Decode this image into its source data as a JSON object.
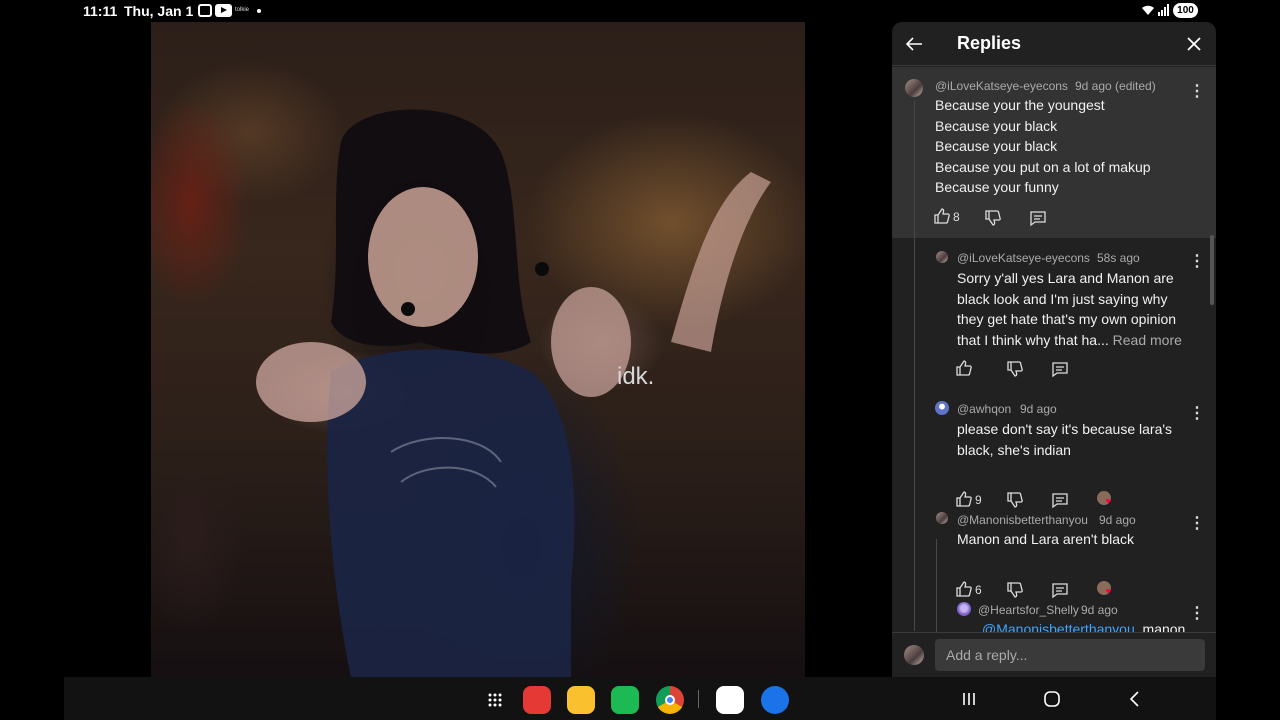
{
  "status_bar": {
    "time": "11:11",
    "date": "Thu, Jan 1",
    "notification_app": "tolkie",
    "battery": "100"
  },
  "video": {
    "caption": "idk."
  },
  "replies_panel": {
    "title": "Replies",
    "comments": [
      {
        "author": "@iLoveKatseye-eyecons",
        "time": "9d ago (edited)",
        "lines": [
          "Because your the youngest",
          "Because your black",
          "Because your black",
          "Because you put on a lot of makup",
          "Because your funny"
        ],
        "likes": "8"
      },
      {
        "author": "@iLoveKatseye-eyecons",
        "time": "58s ago",
        "lines": [
          "Sorry y'all yes Lara and Manon are",
          "black look and I'm just saying why",
          "they get hate that's my own opinion"
        ],
        "truncated_line": "that I think why that ha...",
        "read_more": "Read more",
        "likes": ""
      },
      {
        "author": "@awhqon",
        "time": "9d ago",
        "lines": [
          "please don't say it's because lara's",
          "black, she's indian"
        ],
        "likes": "9"
      },
      {
        "author": "@Manonisbetterthanyou",
        "time": "9d ago",
        "lines": [
          "Manon and Lara aren't black"
        ],
        "likes": "6"
      },
      {
        "author": "@Heartsfor_Shelly",
        "time": "9d ago",
        "mention": "@Manonisbetterthanyou",
        "text": "manon"
      }
    ],
    "reply_placeholder": "Add a reply..."
  },
  "colors": {
    "panel_bg": "#212121",
    "highlight_bg": "#333333",
    "mention": "#3ea6ff",
    "heart": "#ff0033"
  }
}
